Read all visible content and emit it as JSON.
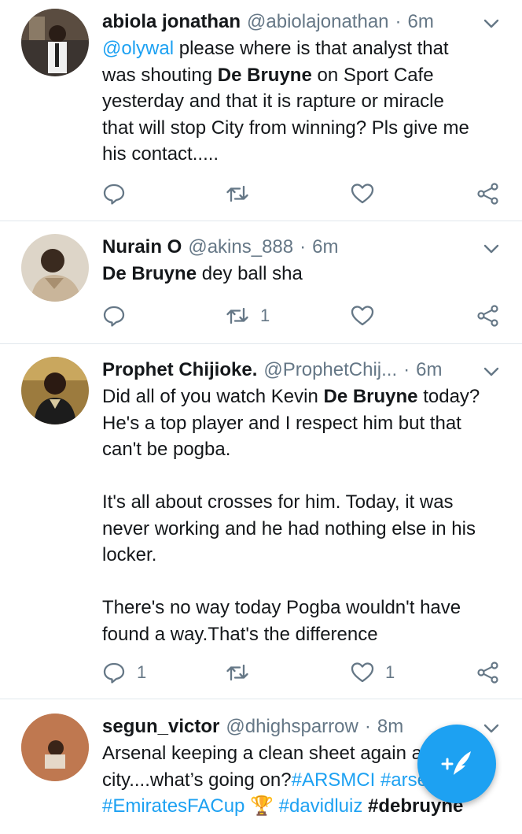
{
  "tweets": [
    {
      "name": "abiola jonathan",
      "handle": "@abiolajonathan",
      "dot": "·",
      "time": "6m",
      "text_parts": [
        {
          "type": "link",
          "text": "@olywal"
        },
        {
          "type": "text",
          "text": " please where is that analyst that\nwas shouting "
        },
        {
          "type": "bold",
          "text": "De Bruyne"
        },
        {
          "type": "text",
          "text": " on Sport Cafe\nyesterday and that it is rapture or miracle\nthat will stop City from winning? Pls give me\nhis contact....."
        }
      ],
      "reply_count": "",
      "retweet_count": "",
      "like_count": ""
    },
    {
      "name": "Nurain O",
      "handle": "@akins_888",
      "dot": "·",
      "time": "6m",
      "text_parts": [
        {
          "type": "bold",
          "text": "De Bruyne"
        },
        {
          "type": "text",
          "text": " dey ball sha"
        }
      ],
      "reply_count": "",
      "retweet_count": "1",
      "like_count": ""
    },
    {
      "name": "Prophet Chijioke.",
      "handle": "@ProphetChij...",
      "dot": "·",
      "time": "6m",
      "text_parts": [
        {
          "type": "text",
          "text": "Did all of you watch Kevin "
        },
        {
          "type": "bold",
          "text": "De Bruyne"
        },
        {
          "type": "text",
          "text": " today?\nHe's a top player and I respect him but that\ncan't be pogba.\n\nIt's all about crosses for him. Today, it was\nnever working and he had nothing else in his\nlocker.\n\nThere's no way today Pogba wouldn't have\nfound a way.That's the difference"
        }
      ],
      "reply_count": "1",
      "retweet_count": "",
      "like_count": "1"
    },
    {
      "name": "segun_victor",
      "handle": "@dhighsparrow",
      "dot": "·",
      "time": "8m",
      "text_parts": [
        {
          "type": "text",
          "text": "Arsenal keeping a clean sheet again against\ncity....what’s going on?"
        },
        {
          "type": "link",
          "text": "#ARSMCI"
        },
        {
          "type": "text",
          "text": " "
        },
        {
          "type": "link",
          "text": "#arsenal"
        },
        {
          "type": "text",
          "text": "\n"
        },
        {
          "type": "link",
          "text": "#EmiratesFACup"
        },
        {
          "type": "text",
          "text": " 🏆 "
        },
        {
          "type": "link",
          "text": "#davidluiz"
        },
        {
          "type": "text",
          "text": " "
        },
        {
          "type": "bold",
          "text": "#debruyne"
        }
      ],
      "reply_count": "",
      "retweet_count": "",
      "like_count": ""
    }
  ],
  "fab": {
    "icon": "compose-tweet-icon"
  },
  "colors": {
    "accent": "#1da1f2",
    "muted": "#657786",
    "text": "#14171a",
    "border": "#e1e8ed"
  }
}
